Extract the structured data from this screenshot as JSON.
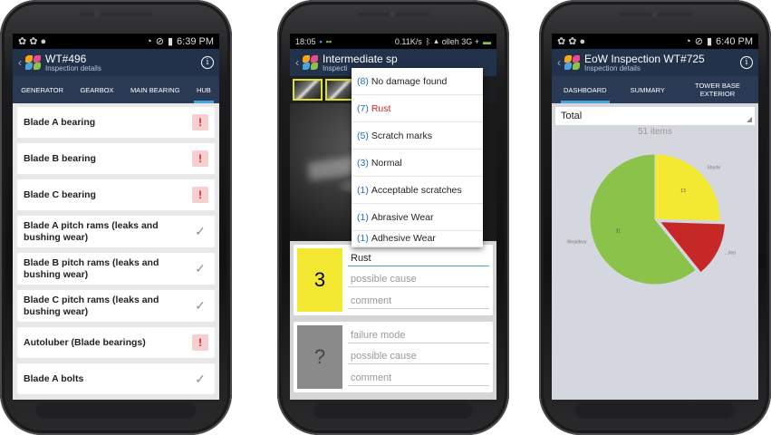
{
  "phones": {
    "p1": {
      "status": {
        "time": "6:39 PM"
      },
      "app": {
        "title": "WT#496",
        "subtitle": "Inspection details"
      },
      "tabs": [
        "GENERATOR",
        "GEARBOX",
        "MAIN BEARING",
        "HUB"
      ],
      "active_tab": 3,
      "items": [
        {
          "label": "Blade A bearing",
          "status": "alert"
        },
        {
          "label": "Blade B bearing",
          "status": "alert"
        },
        {
          "label": "Blade C bearing",
          "status": "alert"
        },
        {
          "label": "Blade A pitch rams (leaks and bushing wear)",
          "status": "check"
        },
        {
          "label": "Blade B pitch rams (leaks and bushing wear)",
          "status": "check"
        },
        {
          "label": "Blade C pitch rams (leaks and bushing wear)",
          "status": "check"
        },
        {
          "label": "Autoluber (Blade bearings)",
          "status": "alert"
        },
        {
          "label": "Blade A bolts",
          "status": "check"
        }
      ],
      "alert_glyph": "!",
      "check_glyph": "✓"
    },
    "p2": {
      "status": {
        "time": "18:05",
        "net": "0.11K/s",
        "carrier": "olleh 3G +"
      },
      "app": {
        "title": "Intermediate sp",
        "subtitle": "Inspecti"
      },
      "dropdown": [
        {
          "count": "(8)",
          "label": "No damage found",
          "highlight": false
        },
        {
          "count": "(7)",
          "label": "Rust",
          "highlight": true
        },
        {
          "count": "(5)",
          "label": "Scratch marks",
          "highlight": false
        },
        {
          "count": "(3)",
          "label": "Normal",
          "highlight": false
        },
        {
          "count": "(1)",
          "label": "Acceptable scratches",
          "highlight": false
        },
        {
          "count": "(1)",
          "label": "Abrasive Wear",
          "highlight": false
        },
        {
          "count": "(1)",
          "label": "Adhesive Wear",
          "highlight": false
        }
      ],
      "cards": [
        {
          "number": "3",
          "color": "#f3e832",
          "failure": "Rust",
          "failure_filled": true,
          "cause": "possible cause",
          "comment": "comment"
        },
        {
          "number": "?",
          "color": "#8a8a8a",
          "failure": "failure mode",
          "failure_filled": false,
          "cause": "possible cause",
          "comment": "comment"
        }
      ]
    },
    "p3": {
      "status": {
        "time": "6:40 PM"
      },
      "app": {
        "title": "EoW Inspection WT#725",
        "subtitle": "Inspection details"
      },
      "tabs": [
        "DASHBOARD",
        "SUMMARY",
        "TOWER BASE EXTERIOR"
      ],
      "active_tab": 0,
      "filter": "Total",
      "items_count": "51 items"
    }
  },
  "chart_data": {
    "type": "pie",
    "values": [
      31,
      13,
      7
    ],
    "slice_labels": [
      "31",
      "13",
      "7"
    ],
    "categories": [
      "Wear/tear",
      "Shorte",
      "...iled"
    ],
    "colors": [
      "#8bc34a",
      "#f3e832",
      "#c62828"
    ],
    "exploded_index": 2
  },
  "colors": {
    "appbar": "#22324a",
    "tabbar": "#2a3a54",
    "accent": "#4aa3df",
    "alert": "#d81e1e"
  }
}
